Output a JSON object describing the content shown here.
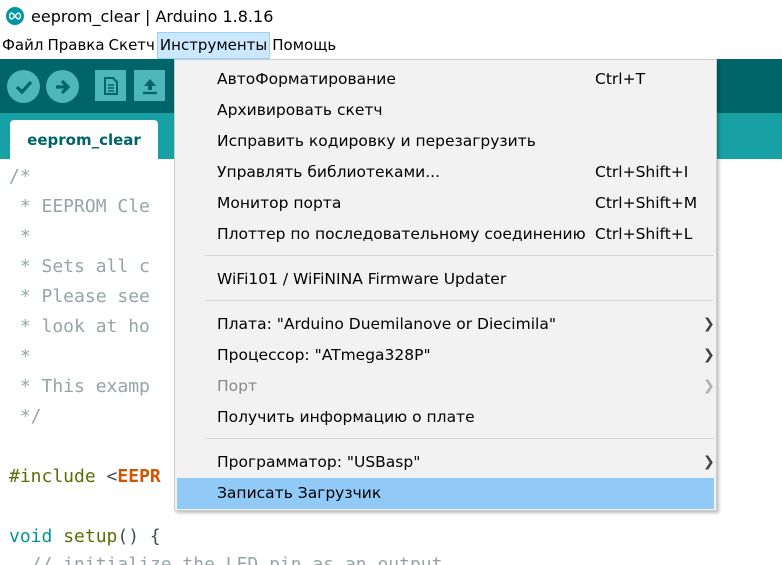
{
  "window": {
    "title": "eeprom_clear | Arduino 1.8.16",
    "icon": "arduino-infinity-icon"
  },
  "menubar": {
    "items": [
      "Файл",
      "Правка",
      "Скетч",
      "Инструменты",
      "Помощь"
    ],
    "active_index": 3
  },
  "toolbar": {
    "buttons": [
      "verify-icon",
      "upload-icon",
      "new-icon",
      "open-icon"
    ]
  },
  "tabs": [
    {
      "label": "eeprom_clear",
      "active": true
    }
  ],
  "editor": {
    "lines": [
      {
        "text": "/*",
        "kind": "comment"
      },
      {
        "text": " * EEPROM Cle",
        "kind": "comment"
      },
      {
        "text": " *",
        "kind": "comment"
      },
      {
        "text": " * Sets all c",
        "kind": "comment"
      },
      {
        "text": " * Please see",
        "kind": "comment"
      },
      {
        "text": " * look at ho",
        "kind": "comment"
      },
      {
        "text": " *",
        "kind": "comment"
      },
      {
        "text": " * This examp",
        "kind": "comment"
      },
      {
        "text": " */",
        "kind": "comment"
      },
      {
        "text": "",
        "kind": "blank"
      },
      {
        "text": "#include <EEPR",
        "kind": "include"
      },
      {
        "text": "",
        "kind": "blank"
      },
      {
        "text": "void setup() {",
        "kind": "setup"
      },
      {
        "text": "  // initialize the LED pin as an output",
        "kind": "comment"
      }
    ]
  },
  "dropdown": {
    "items": [
      {
        "label": "АвтоФорматирование",
        "shortcut": "Ctrl+T"
      },
      {
        "label": "Архивировать скетч",
        "shortcut": ""
      },
      {
        "label": "Исправить кодировку и перезагрузить",
        "shortcut": ""
      },
      {
        "label": "Управлять библиотеками...",
        "shortcut": "Ctrl+Shift+I"
      },
      {
        "label": "Монитор порта",
        "shortcut": "Ctrl+Shift+M"
      },
      {
        "label": "Плоттер по последовательному соединению",
        "shortcut": "Ctrl+Shift+L"
      },
      {
        "label": "WiFi101 / WiFiNINA Firmware Updater",
        "shortcut": ""
      },
      {
        "label": "Плата: \"Arduino Duemilanove or Diecimila\"",
        "shortcut": "",
        "submenu": true
      },
      {
        "label": "Процессор: \"ATmega328P\"",
        "shortcut": "",
        "submenu": true
      },
      {
        "label": "Порт",
        "shortcut": "",
        "submenu": true,
        "disabled": true
      },
      {
        "label": "Получить информацию о плате",
        "shortcut": ""
      },
      {
        "label": "Программатор: \"USBasp\"",
        "shortcut": "",
        "submenu": true
      },
      {
        "label": "Записать Загрузчик",
        "shortcut": "",
        "highlighted": true
      }
    ]
  },
  "colors": {
    "toolbar": "#006468",
    "tabstrip": "#17a1a5",
    "highlight": "#91c9f7"
  }
}
